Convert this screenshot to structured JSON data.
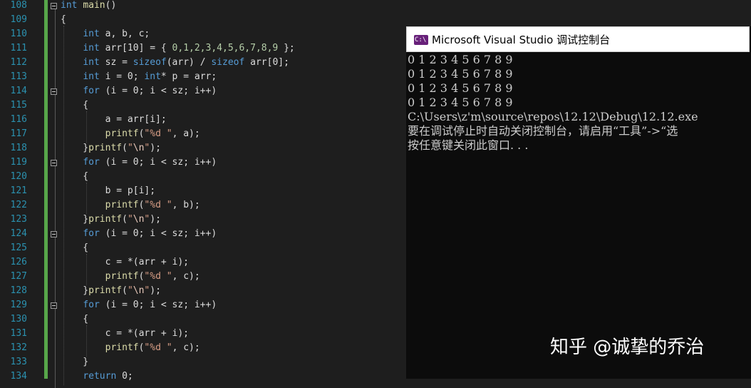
{
  "editor": {
    "line_numbers": [
      "108",
      "109",
      "110",
      "111",
      "112",
      "113",
      "114",
      "115",
      "116",
      "117",
      "118",
      "119",
      "120",
      "121",
      "122",
      "123",
      "124",
      "125",
      "126",
      "127",
      "128",
      "129",
      "130",
      "131",
      "132",
      "133",
      "134"
    ],
    "lines": [
      [
        {
          "t": "int",
          "c": "kw"
        },
        {
          "t": " ",
          "c": "pl"
        },
        {
          "t": "main",
          "c": "fn"
        },
        {
          "t": "()",
          "c": "pl"
        }
      ],
      [
        {
          "t": "{",
          "c": "pl"
        }
      ],
      [
        {
          "t": "    ",
          "c": "pl"
        },
        {
          "t": "int",
          "c": "kw"
        },
        {
          "t": " a, b, c;",
          "c": "pl"
        }
      ],
      [
        {
          "t": "    ",
          "c": "pl"
        },
        {
          "t": "int",
          "c": "kw"
        },
        {
          "t": " arr[10] = { ",
          "c": "pl"
        },
        {
          "t": "0,1,2,3,4,5,6,7,8,9",
          "c": "num"
        },
        {
          "t": " };",
          "c": "pl"
        }
      ],
      [
        {
          "t": "    ",
          "c": "pl"
        },
        {
          "t": "int",
          "c": "kw"
        },
        {
          "t": " sz = ",
          "c": "pl"
        },
        {
          "t": "sizeof",
          "c": "kw"
        },
        {
          "t": "(arr) / ",
          "c": "pl"
        },
        {
          "t": "sizeof",
          "c": "kw"
        },
        {
          "t": " arr[0];",
          "c": "pl"
        }
      ],
      [
        {
          "t": "    ",
          "c": "pl"
        },
        {
          "t": "int",
          "c": "kw"
        },
        {
          "t": " i = 0; ",
          "c": "pl"
        },
        {
          "t": "int",
          "c": "kw"
        },
        {
          "t": "* p = arr;",
          "c": "pl"
        }
      ],
      [
        {
          "t": "    ",
          "c": "pl"
        },
        {
          "t": "for",
          "c": "kw"
        },
        {
          "t": " (i = 0; i < sz; i++)",
          "c": "pl"
        }
      ],
      [
        {
          "t": "    {",
          "c": "pl"
        }
      ],
      [
        {
          "t": "        a = arr[i];",
          "c": "pl"
        }
      ],
      [
        {
          "t": "        ",
          "c": "pl"
        },
        {
          "t": "printf",
          "c": "fn"
        },
        {
          "t": "(",
          "c": "pl"
        },
        {
          "t": "\"%d \"",
          "c": "str"
        },
        {
          "t": ", a);",
          "c": "pl"
        }
      ],
      [
        {
          "t": "    }",
          "c": "pl"
        },
        {
          "t": "printf",
          "c": "fn"
        },
        {
          "t": "(",
          "c": "pl"
        },
        {
          "t": "\"",
          "c": "str"
        },
        {
          "t": "\\n",
          "c": "esc"
        },
        {
          "t": "\"",
          "c": "str"
        },
        {
          "t": ");",
          "c": "pl"
        }
      ],
      [
        {
          "t": "    ",
          "c": "pl"
        },
        {
          "t": "for",
          "c": "kw"
        },
        {
          "t": " (i = 0; i < sz; i++)",
          "c": "pl"
        }
      ],
      [
        {
          "t": "    {",
          "c": "pl"
        }
      ],
      [
        {
          "t": "        b = p[i];",
          "c": "pl"
        }
      ],
      [
        {
          "t": "        ",
          "c": "pl"
        },
        {
          "t": "printf",
          "c": "fn"
        },
        {
          "t": "(",
          "c": "pl"
        },
        {
          "t": "\"%d \"",
          "c": "str"
        },
        {
          "t": ", b);",
          "c": "pl"
        }
      ],
      [
        {
          "t": "    }",
          "c": "pl"
        },
        {
          "t": "printf",
          "c": "fn"
        },
        {
          "t": "(",
          "c": "pl"
        },
        {
          "t": "\"",
          "c": "str"
        },
        {
          "t": "\\n",
          "c": "esc"
        },
        {
          "t": "\"",
          "c": "str"
        },
        {
          "t": ");",
          "c": "pl"
        }
      ],
      [
        {
          "t": "    ",
          "c": "pl"
        },
        {
          "t": "for",
          "c": "kw"
        },
        {
          "t": " (i = 0; i < sz; i++)",
          "c": "pl"
        }
      ],
      [
        {
          "t": "    {",
          "c": "pl"
        }
      ],
      [
        {
          "t": "        c = *(arr + i);",
          "c": "pl"
        }
      ],
      [
        {
          "t": "        ",
          "c": "pl"
        },
        {
          "t": "printf",
          "c": "fn"
        },
        {
          "t": "(",
          "c": "pl"
        },
        {
          "t": "\"%d \"",
          "c": "str"
        },
        {
          "t": ", c);",
          "c": "pl"
        }
      ],
      [
        {
          "t": "    }",
          "c": "pl"
        },
        {
          "t": "printf",
          "c": "fn"
        },
        {
          "t": "(",
          "c": "pl"
        },
        {
          "t": "\"",
          "c": "str"
        },
        {
          "t": "\\n",
          "c": "esc"
        },
        {
          "t": "\"",
          "c": "str"
        },
        {
          "t": ");",
          "c": "pl"
        }
      ],
      [
        {
          "t": "    ",
          "c": "pl"
        },
        {
          "t": "for",
          "c": "kw"
        },
        {
          "t": " (i = 0; i < sz; i++)",
          "c": "pl"
        }
      ],
      [
        {
          "t": "    {",
          "c": "pl"
        }
      ],
      [
        {
          "t": "        c = *(arr + i);",
          "c": "pl"
        }
      ],
      [
        {
          "t": "        ",
          "c": "pl"
        },
        {
          "t": "printf",
          "c": "fn"
        },
        {
          "t": "(",
          "c": "pl"
        },
        {
          "t": "\"%d \"",
          "c": "str"
        },
        {
          "t": ", c);",
          "c": "pl"
        }
      ],
      [
        {
          "t": "    }",
          "c": "pl"
        }
      ],
      [
        {
          "t": "    ",
          "c": "pl"
        },
        {
          "t": "return",
          "c": "kw"
        },
        {
          "t": " 0;",
          "c": "pl"
        }
      ]
    ],
    "colors": {
      "line_number": "#2b91af",
      "keyword": "#569cd6",
      "function": "#dcdcaa",
      "string": "#d69d85",
      "number": "#b5cea8",
      "change_bar": "#57a64a"
    }
  },
  "console": {
    "title": "Microsoft Visual Studio 调试控制台",
    "icon": "visual-studio-console-icon",
    "output_lines": [
      "0 1 2 3 4 5 6 7 8 9",
      "0 1 2 3 4 5 6 7 8 9",
      "0 1 2 3 4 5 6 7 8 9",
      "0 1 2 3 4 5 6 7 8 9",
      "C:\\Users\\z'm\\source\\repos\\12.12\\Debug\\12.12.exe",
      "要在调试停止时自动关闭控制台，请启用“工具”->“选",
      "按任意键关闭此窗口. . ."
    ]
  },
  "watermark": {
    "text": "知乎 @诚挚的乔治"
  }
}
